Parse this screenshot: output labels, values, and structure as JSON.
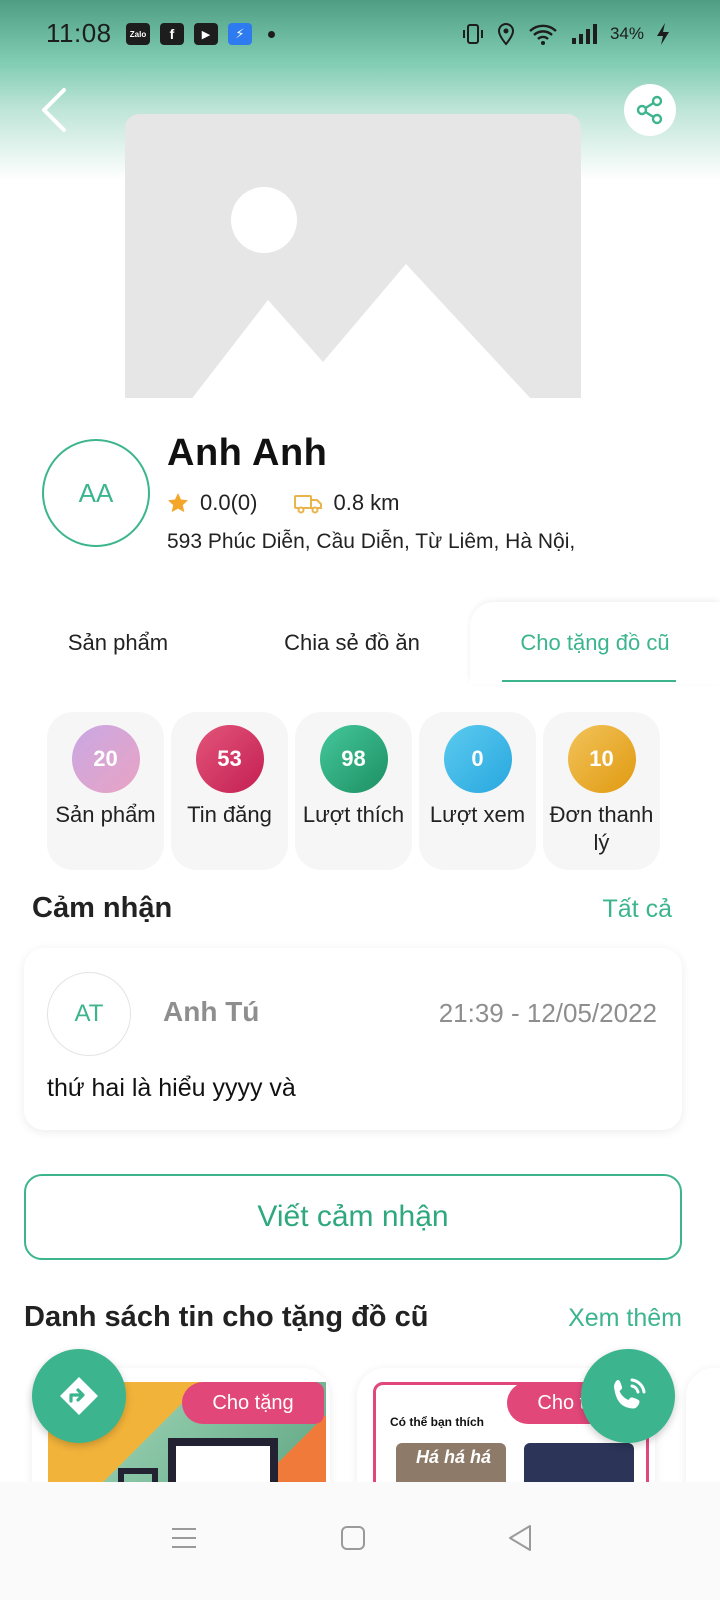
{
  "status_bar": {
    "time": "11:08",
    "battery": "34%",
    "apps": [
      "Zalo",
      "f",
      "▶",
      "⚡"
    ]
  },
  "profile": {
    "initials": "AA",
    "name": "Anh Anh",
    "rating": "0.0(0)",
    "distance": "0.8 km",
    "address": "593 Phúc Diễn, Cầu Diễn, Từ Liêm, Hà Nội,"
  },
  "tabs": [
    {
      "label": "Sản phẩm",
      "active": false
    },
    {
      "label": "Chia sẻ đồ ăn",
      "active": false
    },
    {
      "label": "Cho tặng đồ cũ",
      "active": true
    }
  ],
  "stats": [
    {
      "value": "20",
      "label": "Sản phẩm"
    },
    {
      "value": "53",
      "label": "Tin đăng"
    },
    {
      "value": "98",
      "label": "Lượt thích"
    },
    {
      "value": "0",
      "label": "Lượt xem"
    },
    {
      "value": "10",
      "label": "Đơn thanh lý"
    }
  ],
  "reviews": {
    "title": "Cảm nhận",
    "see_all": "Tất cả",
    "items": [
      {
        "initials": "AT",
        "name": "Anh Tú",
        "time": "21:39 - 12/05/2022",
        "text": "thứ hai là hiểu yyyy và"
      }
    ],
    "write_button": "Viết cảm nhận"
  },
  "listings": {
    "title": "Danh sách tin cho tặng đồ cũ",
    "see_more": "Xem thêm",
    "cards": [
      {
        "tag": "Cho tặng"
      },
      {
        "tag": "Cho tặng",
        "mini_title": "Có thể bạn thích",
        "thumb_text": "Há há há"
      }
    ]
  },
  "colors": {
    "accent": "#3cb58e",
    "tag": "#e2477a"
  },
  "icons": [
    "back-arrow-icon",
    "share-icon",
    "star-icon",
    "truck-icon",
    "directions-icon",
    "phone-icon",
    "menu-icon",
    "home-square-icon",
    "back-triangle-icon"
  ]
}
